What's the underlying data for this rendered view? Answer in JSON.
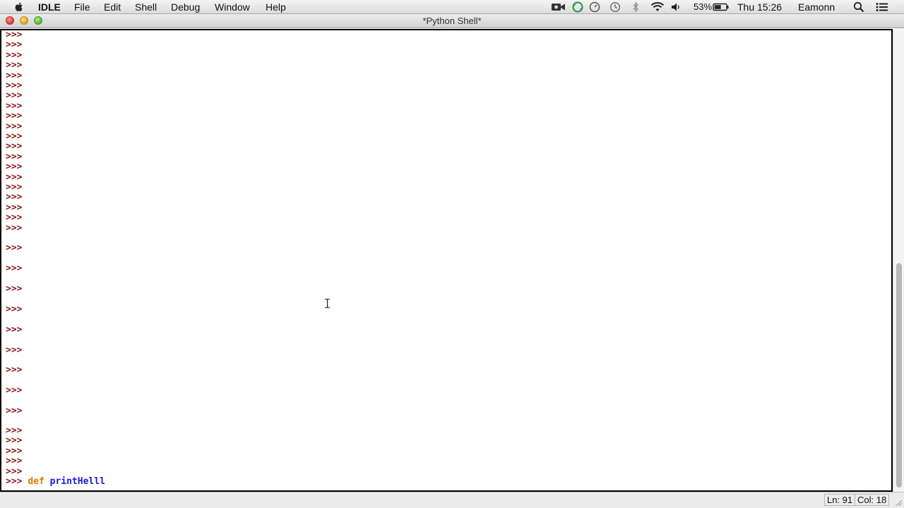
{
  "menubar": {
    "app_name": "IDLE",
    "items": [
      "File",
      "Edit",
      "Shell",
      "Debug",
      "Window",
      "Help"
    ],
    "battery_percent": "53%",
    "clock": "Thu 15:26",
    "user": "Eamonn",
    "status_icons": [
      "camera-icon",
      "sync-icon",
      "dashboard-icon",
      "time-machine-icon",
      "bluetooth-icon",
      "wifi-icon",
      "volume-icon",
      "battery-icon",
      "spotlight-search-icon",
      "notification-list-icon"
    ]
  },
  "window": {
    "title": "*Python Shell*"
  },
  "shell": {
    "prompt": ">>>",
    "current_line": {
      "prompt": ">>>",
      "keyword": "def",
      "identifier": "printHelll"
    }
  },
  "statusbar": {
    "line": "Ln: 91",
    "col": "Col: 18"
  },
  "colors": {
    "prompt": "#8b1a1a",
    "keyword": "#e07b00",
    "definition": "#1a1ae0"
  }
}
